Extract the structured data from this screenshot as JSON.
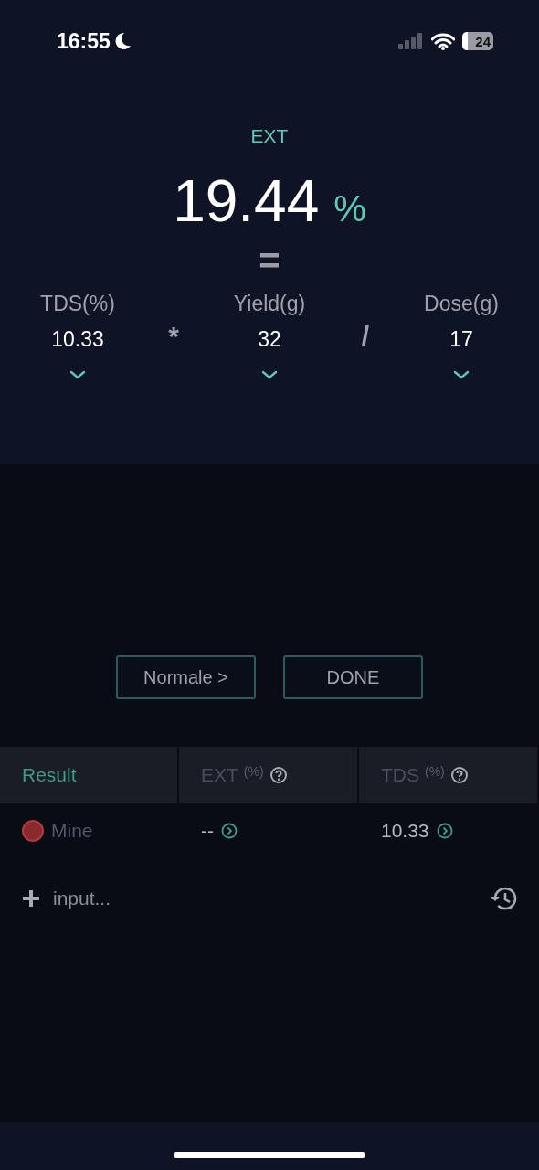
{
  "status_bar": {
    "time": "16:55",
    "battery": "24"
  },
  "result": {
    "label": "EXT",
    "value": "19.44",
    "unit": "%",
    "equals": "="
  },
  "inputs": [
    {
      "label": "TDS(%)",
      "value": "10.33"
    },
    {
      "label": "Yield(g)",
      "value": "32"
    },
    {
      "label": "Dose(g)",
      "value": "17"
    }
  ],
  "operators": [
    "*",
    "/"
  ],
  "buttons": [
    "Normale >",
    "DONE"
  ],
  "table": {
    "columns": [
      {
        "label": "Result",
        "selected": true
      },
      {
        "label": "EXT",
        "unit": "(%)",
        "selected": false
      },
      {
        "label": "TDS",
        "unit": "(%)",
        "selected": false
      }
    ],
    "rows": [
      {
        "color": "#8b2a2e",
        "cells": [
          "Mine",
          "--",
          "10.33"
        ]
      }
    ]
  },
  "input": {
    "placeholder": "input..."
  }
}
